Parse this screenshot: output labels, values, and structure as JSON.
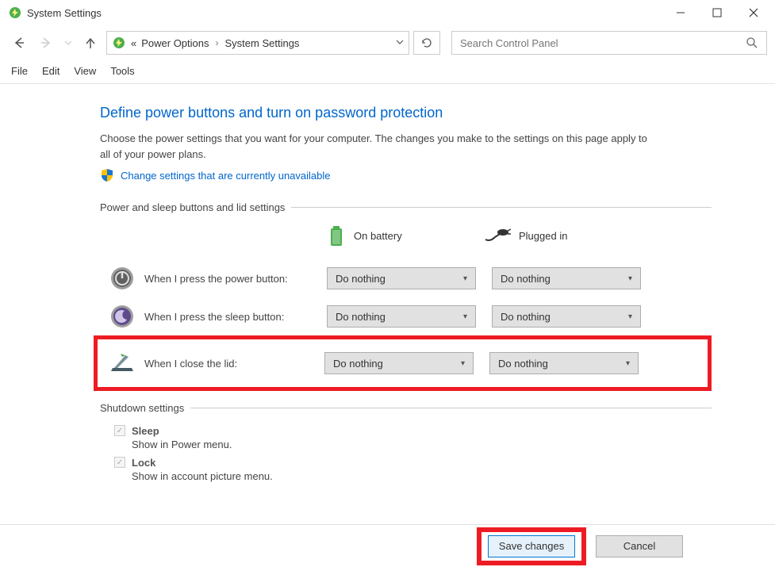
{
  "window": {
    "title": "System Settings",
    "min_tooltip": "Minimize",
    "max_tooltip": "Maximize",
    "close_tooltip": "Close"
  },
  "breadcrumb": {
    "prefix": "«",
    "item1": "Power Options",
    "item2": "System Settings"
  },
  "search": {
    "placeholder": "Search Control Panel"
  },
  "menu": {
    "file": "File",
    "edit": "Edit",
    "view": "View",
    "tools": "Tools"
  },
  "page": {
    "title": "Define power buttons and turn on password protection",
    "description": "Choose the power settings that you want for your computer. The changes you make to the settings on this page apply to all of your power plans.",
    "shield_link": "Change settings that are currently unavailable"
  },
  "section_buttons": {
    "header": "Power and sleep buttons and lid settings",
    "col_battery": "On battery",
    "col_plugged": "Plugged in"
  },
  "rows": {
    "power_button": {
      "label": "When I press the power button:",
      "battery": "Do nothing",
      "plugged": "Do nothing"
    },
    "sleep_button": {
      "label": "When I press the sleep button:",
      "battery": "Do nothing",
      "plugged": "Do nothing"
    },
    "close_lid": {
      "label": "When I close the lid:",
      "battery": "Do nothing",
      "plugged": "Do nothing"
    }
  },
  "shutdown": {
    "header": "Shutdown settings",
    "sleep": {
      "label": "Sleep",
      "desc": "Show in Power menu."
    },
    "lock": {
      "label": "Lock",
      "desc": "Show in account picture menu."
    }
  },
  "footer": {
    "save": "Save changes",
    "cancel": "Cancel"
  }
}
